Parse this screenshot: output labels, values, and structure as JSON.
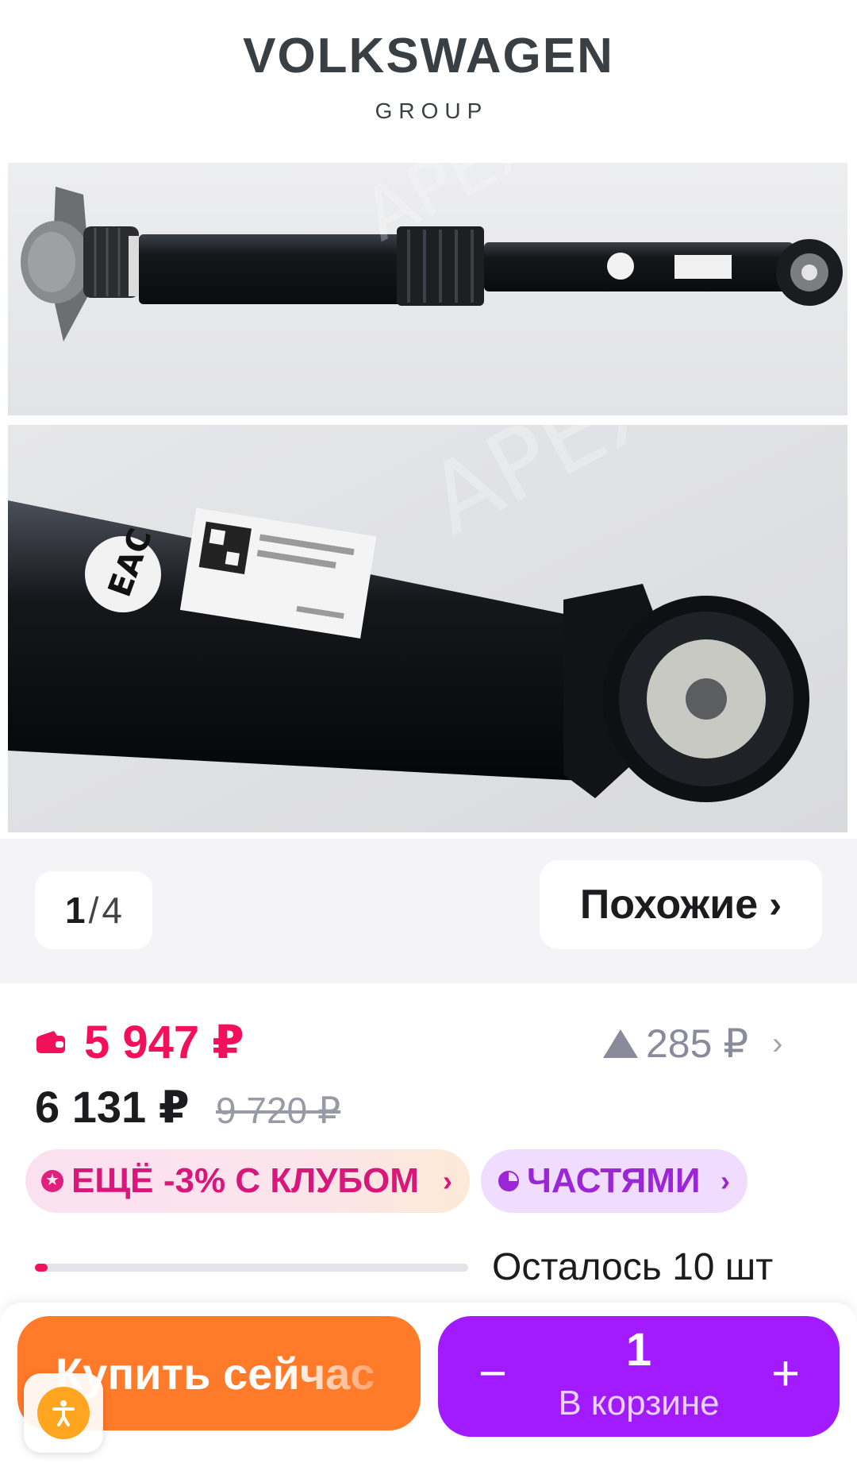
{
  "brand": {
    "name": "VOLKSWAGEN",
    "sub": "GROUP"
  },
  "gallery": {
    "current": "1",
    "separator": "/",
    "total": "4",
    "similar_label": "Похожие",
    "similar_chevron": "›",
    "watermark": "APEX"
  },
  "price": {
    "card_price": "5 947 ₽",
    "price_drop": "285 ₽",
    "price_drop_chevron": "›",
    "regular": "6 131 ₽",
    "old": "9 720 ₽"
  },
  "badges": {
    "club": "ЕЩЁ -3% С КЛУБОМ",
    "parts": "ЧАСТЯМИ",
    "chevron": "›"
  },
  "stock": {
    "text": "Осталось 10 шт",
    "fill_fraction": 0.03
  },
  "bottom": {
    "buy_label": "Купить сейчас",
    "minus": "−",
    "plus": "+",
    "quantity": "1",
    "in_cart": "В корзине"
  },
  "colors": {
    "accent_price": "#f1115a",
    "buy_button": "#ff7a29",
    "cart_button": "#a21bff",
    "club_text": "#d8177a",
    "parts_text": "#9a26d6"
  },
  "icons": {
    "wallet": "wallet-icon",
    "price_down": "triangle-up-icon",
    "accessibility": "accessibility-icon"
  }
}
